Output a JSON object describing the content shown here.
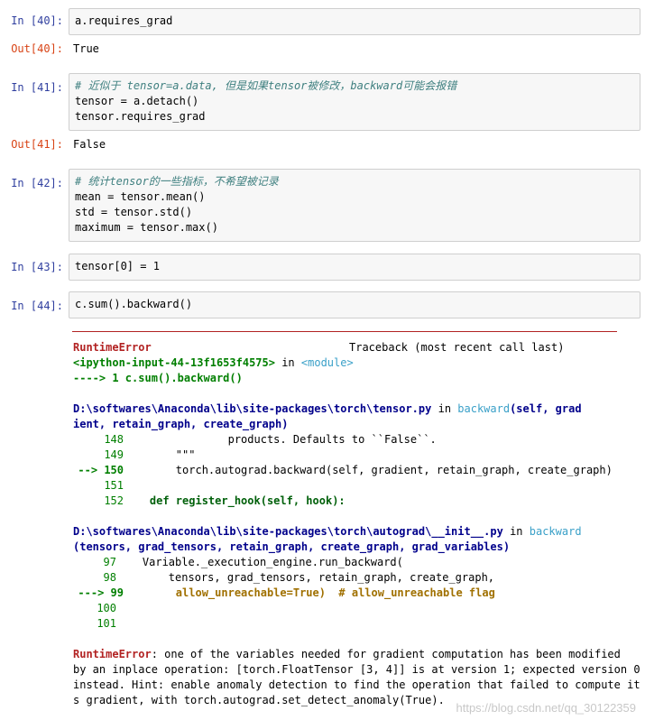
{
  "cells": [
    {
      "prompt": "In  [40]:",
      "lines": [
        "a.requires_grad"
      ]
    },
    {
      "out_prompt": "Out[40]:",
      "out": "True"
    },
    {
      "prompt": "In  [41]:",
      "lines": [
        "# 近似于 tensor=a.data, 但是如果tensor被修改，backward可能会报错",
        "tensor = a.detach()",
        "tensor.requires_grad"
      ]
    },
    {
      "out_prompt": "Out[41]:",
      "out": "False"
    },
    {
      "prompt": "In  [42]:",
      "lines": [
        "# 统计tensor的一些指标，不希望被记录",
        "mean = tensor.mean()",
        "std = tensor.std()",
        "maximum = tensor.max()"
      ]
    },
    {
      "prompt": "In  [43]:",
      "lines": [
        "tensor[0] = 1"
      ]
    },
    {
      "prompt": "In  [44]:",
      "lines": [
        "c.sum().backward()"
      ]
    }
  ],
  "traceback": {
    "error_name": "RuntimeError",
    "header_right": "Traceback (most recent call last)",
    "ipython_input": "<ipython-input-44-13f1653f4575>",
    "in_word": "in",
    "module": "<module>",
    "arrow1": "----> 1 c.sum().backward()",
    "file1": "D:\\softwares\\Anaconda\\lib\\site-packages\\torch\\tensor.py",
    "func1": "backward",
    "sig1a": "(self, grad",
    "sig1b": "ient, retain_graph, create_graph)",
    "f1_lines": [
      {
        "no": "148",
        "code": "                products. Defaults to ``False``."
      },
      {
        "no": "149",
        "code": "        \"\"\""
      },
      {
        "no": "--> 150",
        "code": "        torch.autograd.backward(self, gradient, retain_graph, create_graph)",
        "arrow": true
      },
      {
        "no": "151",
        "code": ""
      },
      {
        "no": "152",
        "code": "    def register_hook(self, hook):"
      }
    ],
    "file2": "D:\\softwares\\Anaconda\\lib\\site-packages\\torch\\autograd\\__init__.py",
    "func2": "backward",
    "sig2": "(tensors, grad_tensors, retain_graph, create_graph, grad_variables)",
    "f2_lines": [
      {
        "no": "97",
        "code": "    Variable._execution_engine.run_backward("
      },
      {
        "no": "98",
        "code": "        tensors, grad_tensors, retain_graph, create_graph,"
      },
      {
        "no": "---> 99",
        "code": "        allow_unreachable=True)  # allow_unreachable flag",
        "arrow": true
      },
      {
        "no": "100",
        "code": ""
      },
      {
        "no": "101",
        "code": ""
      }
    ],
    "final_error": "RuntimeError",
    "final_msg": [
      ": one of the variables needed for gradient computation has been modified",
      "by an inplace operation: [torch.FloatTensor [3, 4]] is at version 1; expected version 0",
      "instead. Hint: enable anomaly detection to find the operation that failed to compute it",
      "s gradient, with torch.autograd.set_detect_anomaly(True)."
    ]
  },
  "watermark": "https://blog.csdn.net/qq_30122359"
}
